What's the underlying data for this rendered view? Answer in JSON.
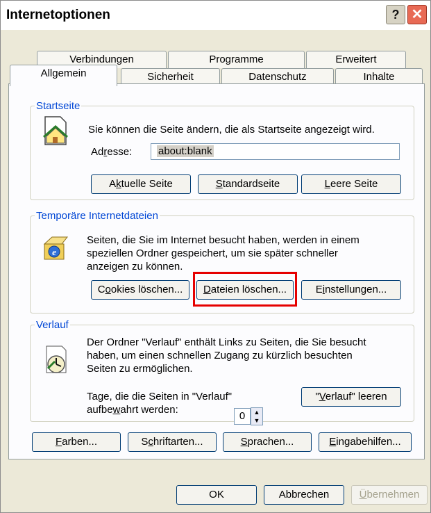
{
  "window": {
    "title": "Internetoptionen",
    "help": "?",
    "close": "✕"
  },
  "tabs": {
    "row1": [
      "Verbindungen",
      "Programme",
      "Erweitert"
    ],
    "row2": [
      "Allgemein",
      "Sicherheit",
      "Datenschutz",
      "Inhalte"
    ],
    "selected": "Allgemein"
  },
  "startseite": {
    "legend": "Startseite",
    "desc": "Sie können die Seite ändern, die als Startseite angezeigt wird.",
    "address_label_a": "Ad",
    "address_label_u": "r",
    "address_label_b": "esse:",
    "address_value": "about:blank",
    "buttons": {
      "current_a": "A",
      "current_u": "k",
      "current_b": "tuelle Seite",
      "default_a": "",
      "default_u": "S",
      "default_b": "tandardseite",
      "blank_a": "",
      "blank_u": "L",
      "blank_b": "eere Seite"
    }
  },
  "temp": {
    "legend": "Temporäre Internetdateien",
    "desc1": "Seiten, die Sie im Internet besucht haben, werden in einem",
    "desc2": "speziellen Ordner gespeichert, um sie später schneller",
    "desc3": "anzeigen zu können.",
    "cookies_a": "C",
    "cookies_u": "o",
    "cookies_b": "okies löschen...",
    "files_a": "",
    "files_u": "D",
    "files_b": "ateien löschen...",
    "settings_a": "E",
    "settings_u": "i",
    "settings_b": "nstellungen..."
  },
  "verlauf": {
    "legend": "Verlauf",
    "desc1": "Der Ordner \"Verlauf\" enthält Links zu Seiten, die Sie besucht",
    "desc2": "haben, um einen schnellen Zugang zu kürzlich besuchten",
    "desc3": "Seiten zu ermöglichen.",
    "days1": "Tage, die die Seiten in \"Verlauf\"",
    "days2_a": "aufbe",
    "days2_u": "w",
    "days2_b": "ahrt werden:",
    "days_value": "0",
    "clear_a": "\"",
    "clear_u": "V",
    "clear_b": "erlauf\" leeren"
  },
  "bottom_buttons": {
    "colors_u": "F",
    "colors_b": "arben...",
    "fonts_a": "S",
    "fonts_u": "c",
    "fonts_b": "hriftarten...",
    "lang_u": "S",
    "lang_b": "prachen...",
    "access_u": "E",
    "access_b": "ingabehilfen..."
  },
  "dialog_buttons": {
    "ok": "OK",
    "cancel": "Abbrechen",
    "apply_u": "Ü",
    "apply_b": "bernehmen"
  }
}
